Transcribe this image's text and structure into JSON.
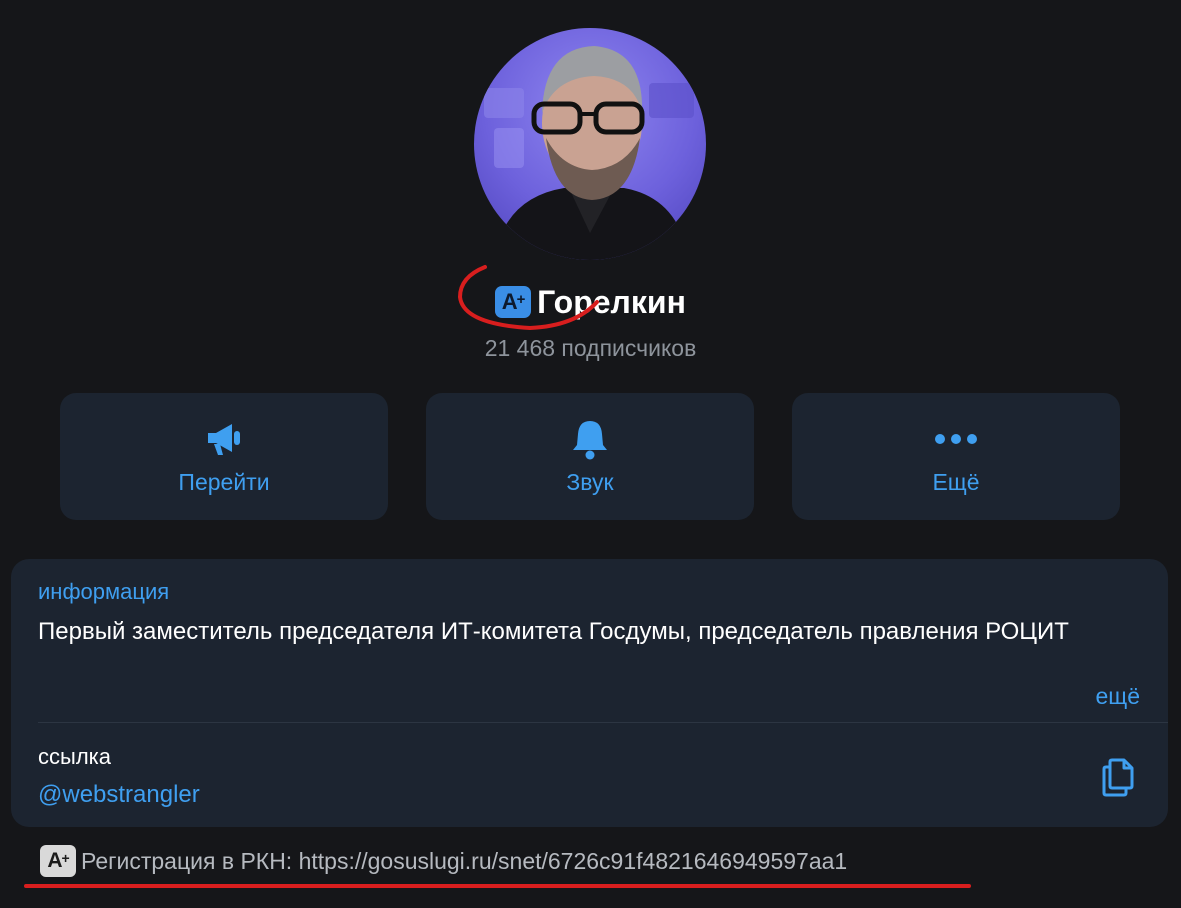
{
  "profile": {
    "badge_text": "A+",
    "name": "Горелкин",
    "subscribers": "21 468 подписчиков"
  },
  "actions": [
    {
      "label": "Перейти",
      "icon": "megaphone-icon"
    },
    {
      "label": "Звук",
      "icon": "bell-icon"
    },
    {
      "label": "Ещё",
      "icon": "ellipsis-icon"
    }
  ],
  "info": {
    "label": "информация",
    "text": "Первый заместитель председателя ИТ-комитета Госдумы, председатель правления РОЦИТ",
    "more": "ещё"
  },
  "link": {
    "label": "ссылка",
    "value": "@webstrangler",
    "icon": "copy-icon"
  },
  "registration": {
    "badge_text": "A+",
    "text": "Регистрация в РКН: https://gosuslugi.ru/snet/6726c91f4821646949597aa1"
  },
  "colors": {
    "background": "#151619",
    "card": "#1c2430",
    "accent": "#3f9ff0",
    "annotation": "#d81e1e"
  }
}
